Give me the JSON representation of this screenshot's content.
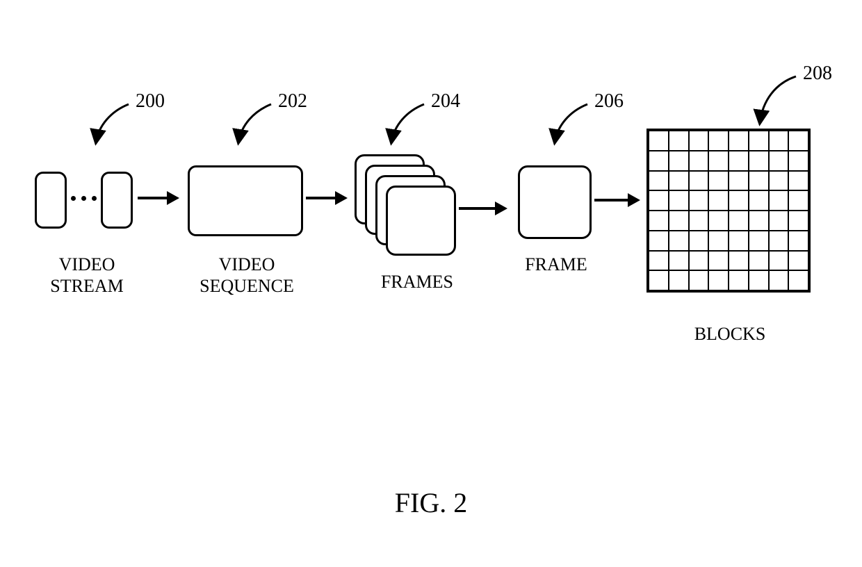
{
  "refs": {
    "stream": "200",
    "sequence": "202",
    "frames": "204",
    "frame": "206",
    "blocks": "208"
  },
  "labels": {
    "stream": "VIDEO\nSTREAM",
    "sequence": "VIDEO\nSEQUENCE",
    "frames": "FRAMES",
    "frame": "FRAME",
    "blocks": "BLOCKS"
  },
  "figure_caption": "FIG. 2",
  "blocks_grid": {
    "rows": 8,
    "cols": 8
  }
}
